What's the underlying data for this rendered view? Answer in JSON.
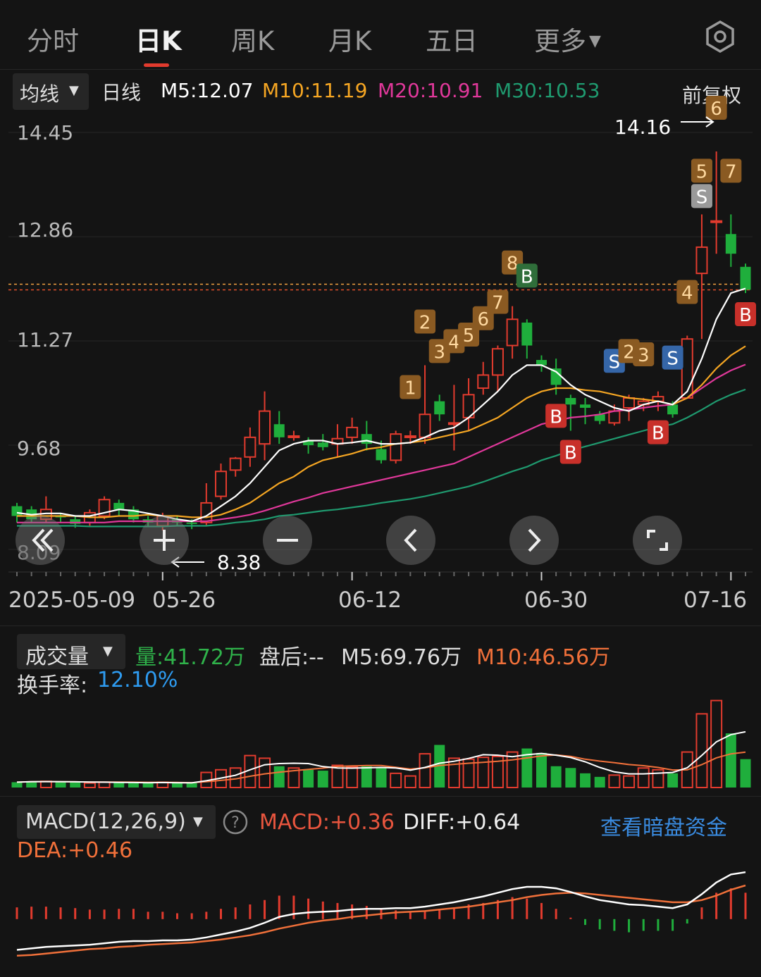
{
  "tabs": [
    {
      "label": "分时"
    },
    {
      "label": "日K"
    },
    {
      "label": "周K"
    },
    {
      "label": "月K"
    },
    {
      "label": "五日"
    },
    {
      "label": "更多"
    }
  ],
  "ma_bar": {
    "indicator_select": "均线",
    "period": "日线",
    "m5": "M5:12.07",
    "m10": "M10:11.19",
    "m20": "M20:10.91",
    "m30": "M30:10.53",
    "adjust": "前复权",
    "colors": {
      "m5": "#ffffff",
      "m10": "#f5a623",
      "m20": "#e0389a",
      "m30": "#1f9a6f"
    }
  },
  "price_axis": [
    "14.45",
    "12.86",
    "11.27",
    "9.68",
    "8.09"
  ],
  "annotations": {
    "high": "14.16",
    "low": "8.38"
  },
  "date_axis": [
    "2025-05-09",
    "05-26",
    "06-12",
    "06-30",
    "07-16"
  ],
  "volume_bar": {
    "indicator_select": "成交量",
    "vol": "量:41.72万",
    "after": "盘后:--",
    "m5": "M5:69.76万",
    "m10": "M10:46.56万",
    "turnover_label": "换手率:",
    "turnover_value": "12.10%"
  },
  "macd_bar": {
    "indicator_select": "MACD(12,26,9)",
    "macd": "MACD:+0.36",
    "diff": "DIFF:+0.64",
    "dea": "DEA:+0.46",
    "link": "查看暗盘资金"
  },
  "colors": {
    "up": "#e23b2e",
    "down": "#1fae3c",
    "bg": "#141414",
    "accent": "#4a90e2"
  },
  "chart_data": {
    "type": "candlestick",
    "price_range": [
      8.09,
      14.45
    ],
    "candles": [
      {
        "o": 8.75,
        "c": 8.6,
        "h": 8.8,
        "l": 8.5
      },
      {
        "o": 8.7,
        "c": 8.55,
        "h": 8.75,
        "l": 8.5
      },
      {
        "o": 8.55,
        "c": 8.7,
        "h": 8.9,
        "l": 8.5
      },
      {
        "o": 8.6,
        "c": 8.58,
        "h": 8.65,
        "l": 8.5
      },
      {
        "o": 8.55,
        "c": 8.48,
        "h": 8.6,
        "l": 8.42
      },
      {
        "o": 8.5,
        "c": 8.65,
        "h": 8.7,
        "l": 8.45
      },
      {
        "o": 8.6,
        "c": 8.85,
        "h": 8.9,
        "l": 8.55
      },
      {
        "o": 8.8,
        "c": 8.7,
        "h": 8.85,
        "l": 8.6
      },
      {
        "o": 8.7,
        "c": 8.55,
        "h": 8.75,
        "l": 8.5
      },
      {
        "o": 8.55,
        "c": 8.5,
        "h": 8.6,
        "l": 8.45
      },
      {
        "o": 8.45,
        "c": 8.6,
        "h": 8.65,
        "l": 8.38
      },
      {
        "o": 8.55,
        "c": 8.5,
        "h": 8.6,
        "l": 8.45
      },
      {
        "o": 8.5,
        "c": 8.48,
        "h": 8.55,
        "l": 8.4
      },
      {
        "o": 8.5,
        "c": 8.8,
        "h": 9.1,
        "l": 8.45
      },
      {
        "o": 8.9,
        "c": 9.28,
        "h": 9.4,
        "l": 8.85
      },
      {
        "o": 9.3,
        "c": 9.48,
        "h": 9.5,
        "l": 9.2
      },
      {
        "o": 9.5,
        "c": 9.8,
        "h": 9.95,
        "l": 9.35
      },
      {
        "o": 9.7,
        "c": 10.2,
        "h": 10.5,
        "l": 9.45
      },
      {
        "o": 10.0,
        "c": 9.8,
        "h": 10.2,
        "l": 9.7
      },
      {
        "o": 9.8,
        "c": 9.82,
        "h": 9.9,
        "l": 9.75
      },
      {
        "o": 9.75,
        "c": 9.68,
        "h": 9.8,
        "l": 9.55
      },
      {
        "o": 9.72,
        "c": 9.65,
        "h": 9.85,
        "l": 9.6
      },
      {
        "o": 9.7,
        "c": 9.78,
        "h": 10.0,
        "l": 9.5
      },
      {
        "o": 9.8,
        "c": 9.95,
        "h": 10.1,
        "l": 9.7
      },
      {
        "o": 9.85,
        "c": 9.7,
        "h": 10.05,
        "l": 9.6
      },
      {
        "o": 9.62,
        "c": 9.45,
        "h": 9.75,
        "l": 9.4
      },
      {
        "o": 9.45,
        "c": 9.85,
        "h": 9.9,
        "l": 9.4
      },
      {
        "o": 9.8,
        "c": 9.82,
        "h": 9.9,
        "l": 9.7
      },
      {
        "o": 9.8,
        "c": 10.15,
        "h": 10.9,
        "l": 9.7
      },
      {
        "o": 10.35,
        "c": 10.15,
        "h": 10.45,
        "l": 10.05
      },
      {
        "o": 10.0,
        "c": 10.02,
        "h": 10.6,
        "l": 9.6
      },
      {
        "o": 10.1,
        "c": 10.45,
        "h": 10.7,
        "l": 9.9
      },
      {
        "o": 10.55,
        "c": 10.75,
        "h": 10.95,
        "l": 10.45
      },
      {
        "o": 10.75,
        "c": 11.15,
        "h": 11.2,
        "l": 10.5
      },
      {
        "o": 11.2,
        "c": 11.6,
        "h": 11.8,
        "l": 11.0
      },
      {
        "o": 11.55,
        "c": 11.2,
        "h": 11.6,
        "l": 11.0
      },
      {
        "o": 10.98,
        "c": 10.9,
        "h": 11.05,
        "l": 10.8
      },
      {
        "o": 10.85,
        "c": 10.6,
        "h": 11.0,
        "l": 10.45
      },
      {
        "o": 10.4,
        "c": 10.3,
        "h": 10.45,
        "l": 9.9
      },
      {
        "o": 10.3,
        "c": 10.25,
        "h": 10.4,
        "l": 10.0
      },
      {
        "o": 10.15,
        "c": 10.05,
        "h": 10.2,
        "l": 10.0
      },
      {
        "o": 10.02,
        "c": 10.2,
        "h": 10.3,
        "l": 9.98
      },
      {
        "o": 10.25,
        "c": 10.4,
        "h": 10.45,
        "l": 10.05
      },
      {
        "o": 10.3,
        "c": 10.35,
        "h": 10.4,
        "l": 10.2
      },
      {
        "o": 10.35,
        "c": 10.42,
        "h": 10.5,
        "l": 10.2
      },
      {
        "o": 10.3,
        "c": 10.15,
        "h": 10.35,
        "l": 10.1
      },
      {
        "o": 10.4,
        "c": 11.3,
        "h": 11.35,
        "l": 10.4
      },
      {
        "o": 12.3,
        "c": 12.7,
        "h": 13.2,
        "l": 11.3
      },
      {
        "o": 13.1,
        "c": 13.1,
        "h": 14.16,
        "l": 12.6
      },
      {
        "o": 12.9,
        "c": 12.6,
        "h": 13.2,
        "l": 12.4
      },
      {
        "o": 12.4,
        "c": 12.05,
        "h": 12.45,
        "l": 12.0
      }
    ],
    "ma5": [
      8.65,
      8.62,
      8.64,
      8.64,
      8.6,
      8.6,
      8.65,
      8.7,
      8.68,
      8.64,
      8.6,
      8.55,
      8.52,
      8.6,
      8.75,
      8.9,
      9.1,
      9.35,
      9.6,
      9.7,
      9.75,
      9.75,
      9.7,
      9.72,
      9.75,
      9.7,
      9.7,
      9.72,
      9.8,
      9.9,
      9.95,
      10.1,
      10.3,
      10.5,
      10.75,
      10.9,
      10.9,
      10.8,
      10.6,
      10.45,
      10.35,
      10.25,
      10.2,
      10.3,
      10.35,
      10.3,
      10.5,
      11.0,
      11.6,
      12.0,
      12.07
    ],
    "ma10": [
      8.6,
      8.6,
      8.6,
      8.6,
      8.6,
      8.58,
      8.58,
      8.6,
      8.6,
      8.62,
      8.6,
      8.6,
      8.58,
      8.58,
      8.62,
      8.7,
      8.8,
      8.95,
      9.1,
      9.2,
      9.35,
      9.45,
      9.5,
      9.55,
      9.62,
      9.65,
      9.7,
      9.72,
      9.75,
      9.8,
      9.85,
      9.9,
      10.0,
      10.1,
      10.25,
      10.4,
      10.5,
      10.55,
      10.55,
      10.52,
      10.5,
      10.45,
      10.4,
      10.38,
      10.35,
      10.3,
      10.4,
      10.6,
      10.85,
      11.05,
      11.19
    ],
    "ma20": [
      8.5,
      8.5,
      8.5,
      8.5,
      8.5,
      8.5,
      8.5,
      8.52,
      8.52,
      8.52,
      8.52,
      8.52,
      8.52,
      8.52,
      8.55,
      8.58,
      8.62,
      8.68,
      8.75,
      8.82,
      8.88,
      8.95,
      9.0,
      9.05,
      9.1,
      9.15,
      9.2,
      9.25,
      9.3,
      9.35,
      9.4,
      9.5,
      9.6,
      9.7,
      9.8,
      9.9,
      10.0,
      10.05,
      10.1,
      10.12,
      10.15,
      10.2,
      10.22,
      10.25,
      10.28,
      10.3,
      10.4,
      10.55,
      10.7,
      10.82,
      10.91
    ],
    "ma30": [
      8.45,
      8.45,
      8.45,
      8.45,
      8.45,
      8.44,
      8.44,
      8.44,
      8.44,
      8.44,
      8.44,
      8.45,
      8.45,
      8.45,
      8.47,
      8.5,
      8.52,
      8.55,
      8.6,
      8.62,
      8.65,
      8.68,
      8.7,
      8.73,
      8.76,
      8.8,
      8.83,
      8.86,
      8.9,
      8.95,
      9.0,
      9.05,
      9.12,
      9.2,
      9.28,
      9.35,
      9.45,
      9.52,
      9.6,
      9.66,
      9.72,
      9.78,
      9.84,
      9.9,
      9.96,
      10.0,
      10.1,
      10.22,
      10.35,
      10.45,
      10.53
    ],
    "volume": [
      6,
      7,
      7,
      6,
      6,
      5,
      6,
      6,
      5,
      5,
      6,
      5,
      5,
      17,
      20,
      22,
      36,
      33,
      24,
      22,
      20,
      19,
      25,
      23,
      24,
      22,
      16,
      13,
      38,
      48,
      33,
      32,
      34,
      35,
      40,
      44,
      39,
      24,
      22,
      16,
      12,
      14,
      13,
      22,
      20,
      16,
      40,
      83,
      98,
      61,
      32
    ],
    "volume_range": [
      0,
      100
    ],
    "diff": [
      -0.42,
      -0.4,
      -0.38,
      -0.37,
      -0.36,
      -0.35,
      -0.33,
      -0.31,
      -0.3,
      -0.3,
      -0.29,
      -0.29,
      -0.28,
      -0.25,
      -0.21,
      -0.17,
      -0.12,
      -0.05,
      0.03,
      0.07,
      0.09,
      0.1,
      0.11,
      0.13,
      0.14,
      0.14,
      0.15,
      0.15,
      0.17,
      0.2,
      0.23,
      0.27,
      0.31,
      0.36,
      0.41,
      0.44,
      0.44,
      0.42,
      0.37,
      0.31,
      0.26,
      0.23,
      0.2,
      0.19,
      0.17,
      0.15,
      0.2,
      0.34,
      0.5,
      0.61,
      0.64
    ],
    "dea": [
      -0.5,
      -0.49,
      -0.47,
      -0.45,
      -0.43,
      -0.41,
      -0.4,
      -0.38,
      -0.37,
      -0.35,
      -0.34,
      -0.33,
      -0.32,
      -0.3,
      -0.28,
      -0.25,
      -0.22,
      -0.18,
      -0.13,
      -0.09,
      -0.05,
      -0.02,
      0.0,
      0.03,
      0.05,
      0.07,
      0.09,
      0.1,
      0.11,
      0.13,
      0.15,
      0.17,
      0.2,
      0.23,
      0.26,
      0.3,
      0.33,
      0.35,
      0.36,
      0.35,
      0.33,
      0.31,
      0.29,
      0.27,
      0.25,
      0.23,
      0.23,
      0.26,
      0.32,
      0.4,
      0.46
    ],
    "macd": [
      0.16,
      0.17,
      0.17,
      0.16,
      0.15,
      0.13,
      0.13,
      0.14,
      0.14,
      0.1,
      0.1,
      0.08,
      0.08,
      0.1,
      0.14,
      0.16,
      0.2,
      0.26,
      0.32,
      0.32,
      0.28,
      0.24,
      0.22,
      0.2,
      0.18,
      0.14,
      0.12,
      0.1,
      0.12,
      0.14,
      0.16,
      0.2,
      0.22,
      0.26,
      0.3,
      0.28,
      0.22,
      0.14,
      0.02,
      -0.08,
      -0.14,
      -0.16,
      -0.18,
      -0.16,
      -0.16,
      -0.16,
      -0.06,
      0.16,
      0.36,
      0.42,
      0.36
    ],
    "macd_range": [
      -0.55,
      0.7
    ],
    "signals": [
      {
        "i": 27,
        "t": "1",
        "k": "num"
      },
      {
        "i": 28,
        "t": "2",
        "k": "num"
      },
      {
        "i": 29,
        "t": "3",
        "k": "num"
      },
      {
        "i": 30,
        "t": "4",
        "k": "num"
      },
      {
        "i": 31,
        "t": "5",
        "k": "num"
      },
      {
        "i": 32,
        "t": "6",
        "k": "num"
      },
      {
        "i": 33,
        "t": "7",
        "k": "num"
      },
      {
        "i": 34,
        "t": "8",
        "k": "num"
      },
      {
        "i": 35,
        "t": "B",
        "k": "buy_top"
      },
      {
        "i": 37,
        "t": "B",
        "k": "buy"
      },
      {
        "i": 38,
        "t": "B",
        "k": "buy"
      },
      {
        "i": 41,
        "t": "S",
        "k": "sell"
      },
      {
        "i": 42,
        "t": "2",
        "k": "num"
      },
      {
        "i": 43,
        "t": "3",
        "k": "num"
      },
      {
        "i": 44,
        "t": "B",
        "k": "buy"
      },
      {
        "i": 45,
        "t": "S",
        "k": "sell"
      },
      {
        "i": 46,
        "t": "4",
        "k": "num"
      },
      {
        "i": 47,
        "t": "5",
        "k": "num"
      },
      {
        "i": 47,
        "t": "S",
        "k": "sell_grey"
      },
      {
        "i": 48,
        "t": "6",
        "k": "num"
      },
      {
        "i": 49,
        "t": "7",
        "k": "num"
      },
      {
        "i": 50,
        "t": "B",
        "k": "buy"
      }
    ]
  }
}
